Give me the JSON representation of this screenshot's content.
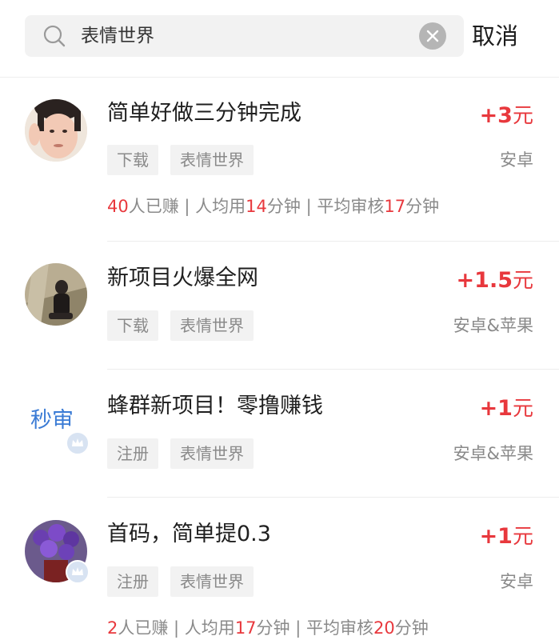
{
  "search": {
    "query": "表情世界",
    "cancel_label": "取消"
  },
  "items": [
    {
      "title": "简单好做三分钟完成",
      "price_value": "+3",
      "price_unit": "元",
      "tags": [
        "下载",
        "表情世界"
      ],
      "platform": "安卓",
      "stats": {
        "earned_count": "40",
        "earned_label": "人已赚 | 人均用",
        "avg_minutes": "14",
        "avg_label": "分钟 | 平均审核",
        "review_minutes": "17",
        "review_label": "分钟"
      }
    },
    {
      "title": "新项目火爆全网",
      "price_value": "+1.5",
      "price_unit": "元",
      "tags": [
        "下载",
        "表情世界"
      ],
      "platform": "安卓&苹果"
    },
    {
      "title": "蜂群新项目！零撸赚钱",
      "price_value": "+1",
      "price_unit": "元",
      "tags": [
        "注册",
        "表情世界"
      ],
      "platform": "安卓&苹果",
      "avatar_text": "秒审"
    },
    {
      "title": "首码，简单提0.3",
      "price_value": "+1",
      "price_unit": "元",
      "tags": [
        "注册",
        "表情世界"
      ],
      "platform": "安卓",
      "stats": {
        "earned_count": "2",
        "earned_label": "人已赚 | 人均用",
        "avg_minutes": "17",
        "avg_label": "分钟 | 平均审核",
        "review_minutes": "20",
        "review_label": "分钟"
      }
    }
  ],
  "colors": {
    "accent": "#e8383d",
    "muted": "#8a8a8a",
    "tag_bg": "#f2f2f2",
    "link": "#3a7bd5"
  }
}
